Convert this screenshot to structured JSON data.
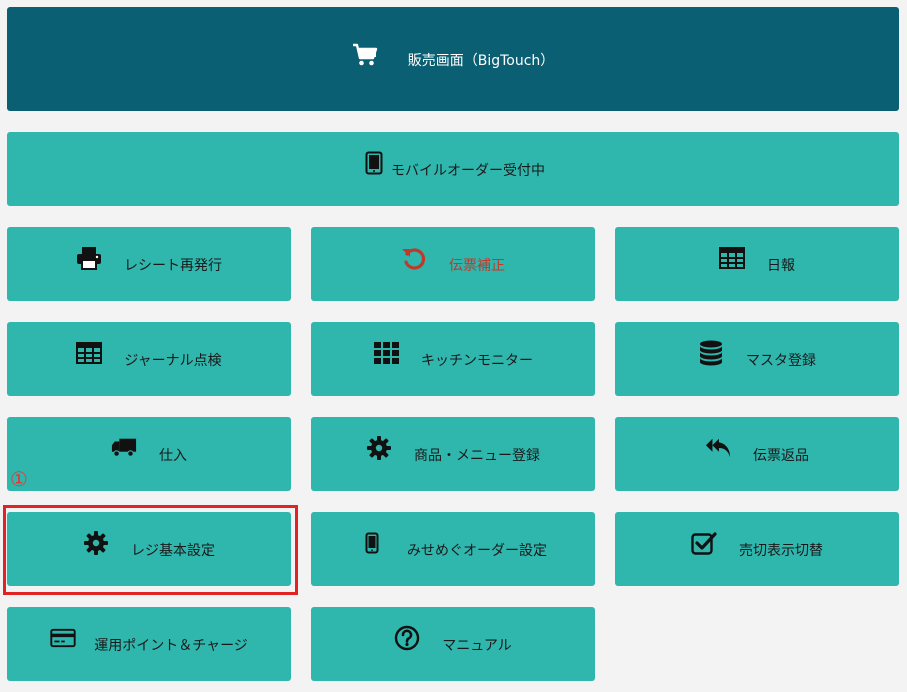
{
  "buttons": {
    "sales_screen": "販売画面（BigTouch）",
    "mobile_order": "モバイルオーダー受付中",
    "receipt_reissue": "レシート再発行",
    "slip_correction": "伝票補正",
    "daily_report": "日報",
    "journal_check": "ジャーナル点検",
    "kitchen_monitor": "キッチンモニター",
    "master_register": "マスタ登録",
    "purchase": "仕入",
    "product_menu_register": "商品・メニュー登録",
    "slip_return": "伝票返品",
    "register_settings": "レジ基本設定",
    "misemegu_order_settings": "みせめぐオーダー設定",
    "soldout_display_switch": "売切表示切替",
    "point_charge": "運用ポイント＆チャージ",
    "manual": "マニュアル"
  },
  "annotation": {
    "marker": "①"
  },
  "colors": {
    "primary_dark": "#0b5f72",
    "teal": "#2fb6ad",
    "highlight_red": "#e02424",
    "alert_text": "#c0392b"
  },
  "icons": {
    "sales_screen": "cart-icon",
    "mobile_order": "tablet-icon",
    "receipt_reissue": "printer-icon",
    "slip_correction": "undo-icon",
    "daily_report": "table-icon",
    "journal_check": "table-icon",
    "kitchen_monitor": "grid-icon",
    "master_register": "database-icon",
    "purchase": "truck-icon",
    "product_menu_register": "gear-icon",
    "slip_return": "reply-all-icon",
    "register_settings": "gear-icon",
    "misemegu_order_settings": "mobile-icon",
    "soldout_display_switch": "checkbox-icon",
    "point_charge": "credit-card-icon",
    "manual": "question-circle-icon"
  }
}
